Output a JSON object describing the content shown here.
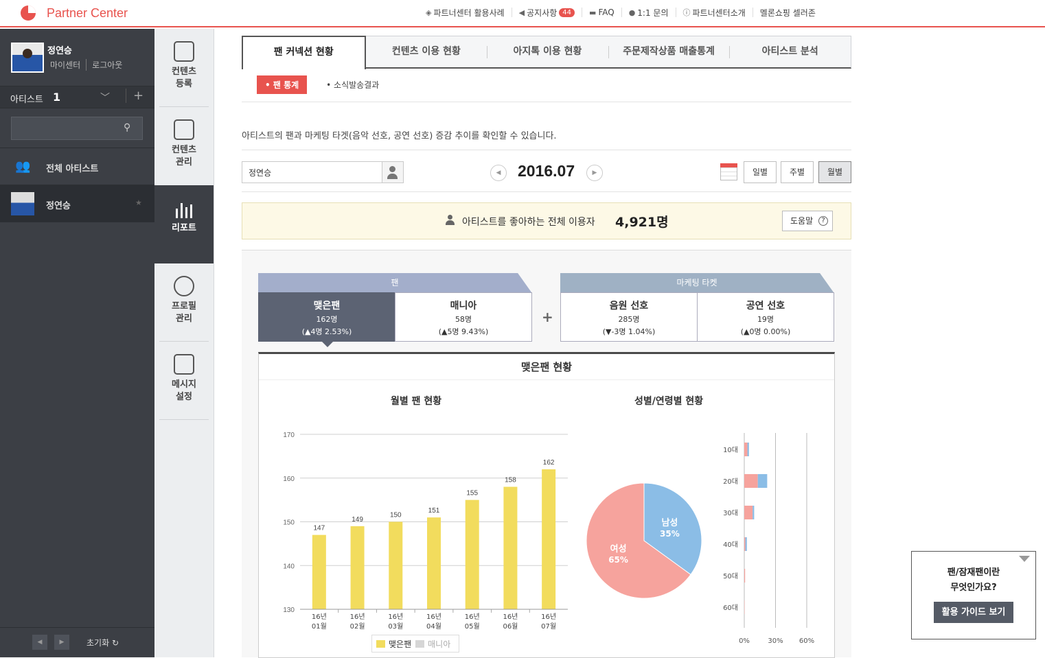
{
  "header": {
    "brand": "Partner Center",
    "nav": [
      {
        "label": "파트너센터 활용사례",
        "icon": "layers-icon"
      },
      {
        "label": "공지사항",
        "icon": "megaphone-icon",
        "badge": "44"
      },
      {
        "label": "FAQ",
        "icon": "folder-icon"
      },
      {
        "label": "1:1 문의",
        "icon": "chat-icon"
      },
      {
        "label": "파트너센터소개",
        "icon": "info-icon"
      },
      {
        "label": "멜론쇼핑 셀러존",
        "icon": ""
      }
    ]
  },
  "sidebar": {
    "user_name": "정연승",
    "my_center": "마이센터",
    "logout": "로그아웃",
    "artist_label": "아티스트",
    "artist_count": "1",
    "search_placeholder": "",
    "all_artists": "전체 아티스트",
    "artist_item": "정연승",
    "reset": "초기화"
  },
  "menu": [
    {
      "label1": "컨텐츠",
      "label2": "등록",
      "icon": "content-register-icon"
    },
    {
      "label1": "컨텐츠",
      "label2": "관리",
      "icon": "content-manage-icon"
    },
    {
      "label1": "리포트",
      "label2": "",
      "icon": "report-icon"
    },
    {
      "label1": "프로필",
      "label2": "관리",
      "icon": "profile-manage-icon"
    },
    {
      "label1": "메시지",
      "label2": "설정",
      "icon": "message-settings-icon"
    }
  ],
  "tabs": [
    "팬 커넥션 현황",
    "컨텐츠 이용 현황",
    "아지톡 이용 현황",
    "주문제작상품 매출통계",
    "아티스트 분석"
  ],
  "subtabs": {
    "active": "• 팬 통계",
    "other": "• 소식발송결과"
  },
  "description": "아티스트의 팬과 마케팅 타겟(음악 선호, 공연 선호) 증감 추이를 확인할 수 있습니다.",
  "filter": {
    "artist_value": "정연승",
    "period": "2016.07",
    "daily": "일별",
    "weekly": "주별",
    "monthly": "월별"
  },
  "summary": {
    "label": "아티스트를 좋아하는 전체 이용자",
    "value": "4,921명",
    "help": "도움말"
  },
  "groups": {
    "fan": "팬",
    "marketing": "마케팅 타켓"
  },
  "cards": [
    {
      "title": "맺은팬",
      "count": "162명",
      "delta": "(▲4명  2.53%)"
    },
    {
      "title": "매니아",
      "count": "58명",
      "delta": "(▲5명  9.43%)"
    },
    {
      "title": "음원 선호",
      "count": "285명",
      "delta": "(▼-3명  1.04%)"
    },
    {
      "title": "공연 선호",
      "count": "19명",
      "delta": "(▲0명  0.00%)"
    }
  ],
  "panel": {
    "title": "맺은팬 현황",
    "monthly_title": "월별 팬 현황",
    "demo_title": "성별/연령별 현황"
  },
  "legend": {
    "a": "맺은팬",
    "b": "매니아",
    "a_color": "#f2dc5d",
    "b_color": "#d6d6d6"
  },
  "chart_data": [
    {
      "type": "bar",
      "title": "월별 팬 현황",
      "categories": [
        "16년 01월",
        "16년 02월",
        "16년 03월",
        "16년 04월",
        "16년 05월",
        "16년 06월",
        "16년 07월"
      ],
      "series": [
        {
          "name": "맺은팬",
          "values": [
            147,
            149,
            150,
            151,
            155,
            158,
            162
          ]
        }
      ],
      "ylim": [
        130,
        170
      ],
      "yticks": [
        130,
        140,
        150,
        160,
        170
      ],
      "grid": true,
      "legend": "bottom",
      "colors": {
        "bar": "#f2dc5d"
      }
    },
    {
      "type": "pie",
      "title": "성별/연령별 현황",
      "slices": [
        {
          "label": "남성",
          "value": 35,
          "text": "35%",
          "color": "#8bbde6"
        },
        {
          "label": "여성",
          "value": 65,
          "text": "65%",
          "color": "#f6a39d"
        }
      ]
    },
    {
      "type": "bar",
      "orientation": "horizontal",
      "categories": [
        "10대",
        "20대",
        "30대",
        "40대",
        "50대",
        "60대"
      ],
      "series": [
        {
          "values": [
            3,
            13,
            8,
            1,
            0.8,
            0.3
          ],
          "color": "#f6a39d"
        },
        {
          "values": [
            1.5,
            9,
            1.5,
            1.5,
            0,
            0
          ],
          "color": "#8bbde6"
        }
      ],
      "xticks": [
        "0%",
        "30%",
        "60%"
      ],
      "xlim": [
        0,
        60
      ]
    }
  ],
  "guide": {
    "line1": "팬/잠재팬이란",
    "line2": "무엇인가요?",
    "button": "활용 가이드 보기"
  }
}
